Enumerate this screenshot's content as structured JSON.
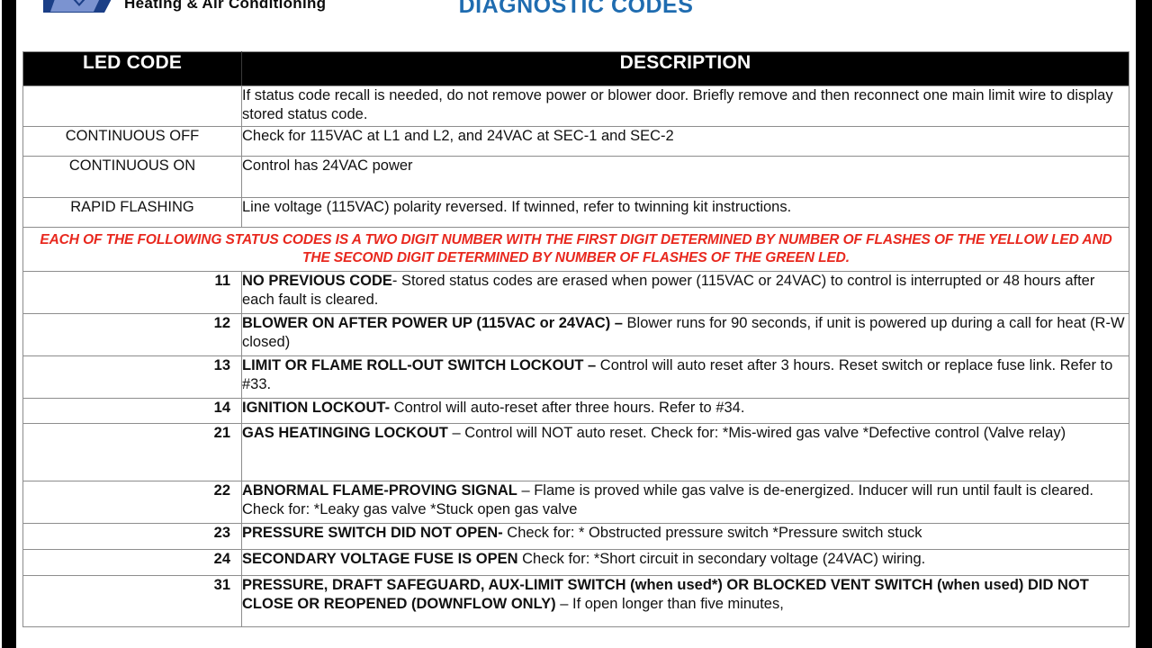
{
  "header": {
    "brand_name": "Heating  &  Air Conditioning",
    "logo_icon": "brand-chevron-logo",
    "document_title": "DIAGNOSTIC CODES",
    "title_color": "#1f6cb0"
  },
  "table": {
    "columns": [
      "LED CODE",
      "DESCRIPTION"
    ],
    "note": {
      "color": "#e8281e",
      "text": "EACH OF THE FOLLOWING STATUS CODES IS A TWO DIGIT NUMBER WITH THE FIRST DIGIT DETERMINED BY NUMBER OF FLASHES OF THE YELLOW LED AND THE SECOND DIGIT DETERMINED BY NUMBER OF FLASHES OF THE GREEN LED."
    },
    "rows": [
      {
        "code": "",
        "bold": "",
        "text": "If status code recall is needed, do not remove power or blower door. Briefly remove and then reconnect one main limit wire to display  stored status code."
      },
      {
        "code": "CONTINUOUS OFF",
        "bold": "",
        "text": "Check for 115VAC at L1 and L2, and 24VAC at SEC-1 and SEC-2"
      },
      {
        "code": "CONTINUOUS ON",
        "bold": "",
        "text": "Control has 24VAC power"
      },
      {
        "code": "RAPID FLASHING",
        "bold": "",
        "text": "Line voltage (115VAC) polarity reversed. If twinned, refer to twinning kit instructions."
      },
      {
        "code": "11",
        "bold": "NO PREVIOUS CODE",
        "text": "- Stored status codes are erased when power (115VAC or 24VAC) to control is interrupted or 48 hours after each fault is cleared."
      },
      {
        "code": "12",
        "bold": "BLOWER ON AFTER POWER UP (115VAC or 24VAC) –",
        "text": " Blower runs for 90 seconds, if unit is powered up during a call for heat (R-W closed)"
      },
      {
        "code": "13",
        "bold": "LIMIT OR FLAME ROLL-OUT SWITCH LOCKOUT –",
        "text": " Control will auto reset after 3 hours. Reset switch or replace fuse link. Refer to #33."
      },
      {
        "code": "14",
        "bold": "IGNITION LOCKOUT-",
        "text": " Control will auto-reset after three hours. Refer to #34."
      },
      {
        "code": "21",
        "bold": "GAS HEATINGING LOCKOUT",
        "text": " – Control will NOT auto reset. Check for:   *Mis-wired gas valve    *Defective control (Valve relay)"
      },
      {
        "code": "22",
        "bold": "ABNORMAL FLAME-PROVING SIGNAL",
        "text": " – Flame is proved while gas valve is de-energized. Inducer will run until fault is cleared.  Check for:  *Leaky gas valve    *Stuck open gas valve"
      },
      {
        "code": "23",
        "bold": "PRESSURE SWITCH DID NOT OPEN-",
        "text": " Check for:  * Obstructed  pressure switch    *Pressure switch stuck"
      },
      {
        "code": "24",
        "bold": "SECONDARY VOLTAGE FUSE IS OPEN",
        "text": " Check for:  *Short circuit in secondary voltage (24VAC) wiring."
      },
      {
        "code": "31",
        "bold": "PRESSURE, DRAFT SAFEGUARD, AUX-LIMIT SWITCH (when used*) OR BLOCKED VENT SWITCH (when used) DID NOT CLOSE OR REOPENED (DOWNFLOW ONLY)",
        "text": " – If open longer than five minutes,"
      }
    ]
  }
}
